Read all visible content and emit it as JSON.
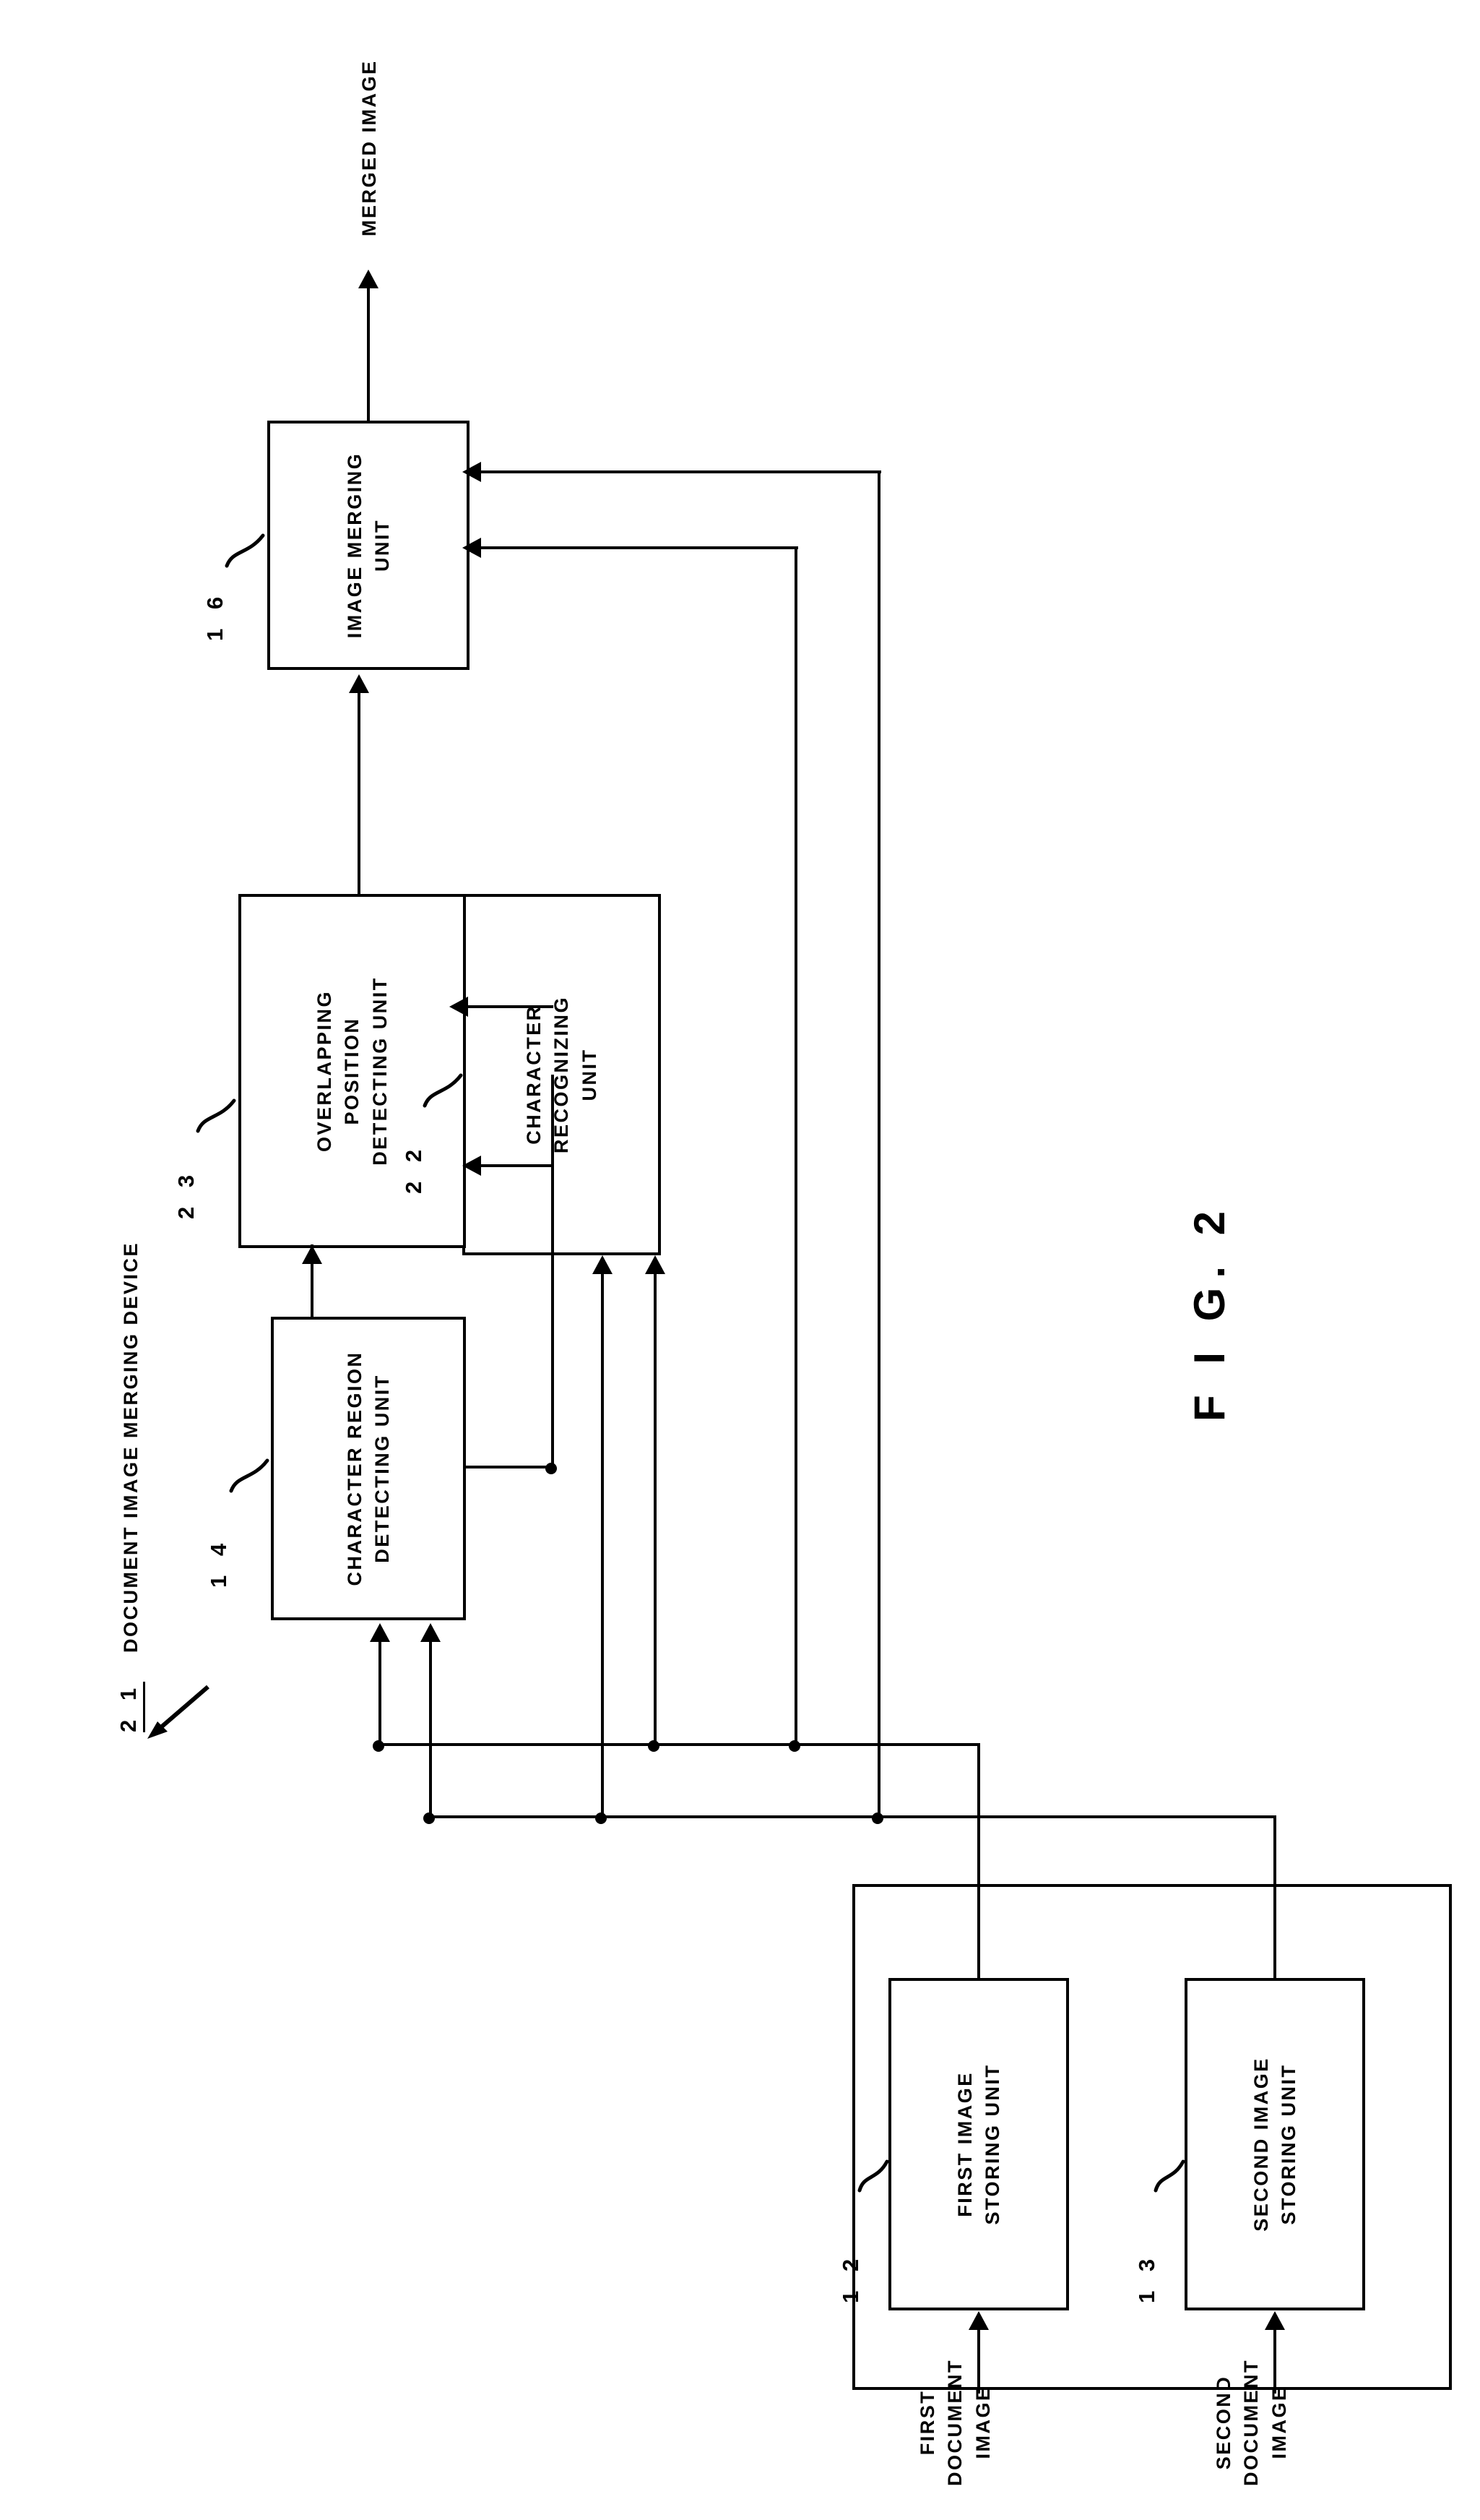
{
  "figure": {
    "caption": "F I G.  2",
    "device_title": "DOCUMENT IMAGE MERGING DEVICE",
    "device_ref": "2 1"
  },
  "blocks": [
    {
      "id": "first-image-storing-unit",
      "ref": "1 2",
      "label": "FIRST IMAGE\nSTORING UNIT"
    },
    {
      "id": "second-image-storing-unit",
      "ref": "1 3",
      "label": "SECOND IMAGE\nSTORING UNIT"
    },
    {
      "id": "character-region-detecting-unit",
      "ref": "1 4",
      "label": "CHARACTER REGION\nDETECTING UNIT"
    },
    {
      "id": "character-recognizing-unit",
      "ref": "2 2",
      "label": "CHARACTER\nRECOGNIZING\nUNIT"
    },
    {
      "id": "overlapping-position-detecting-unit",
      "ref": "2 3",
      "label": "OVERLAPPING\nPOSITION\nDETECTING UNIT"
    },
    {
      "id": "image-merging-unit",
      "ref": "1 6",
      "label": "IMAGE MERGING\nUNIT"
    }
  ],
  "io": {
    "input_first": "FIRST\nDOCUMENT IMAGE",
    "input_second": "SECOND\nDOCUMENT IMAGE",
    "output": "MERGED IMAGE"
  },
  "colors": {
    "ink": "#000000",
    "paper": "#ffffff"
  }
}
